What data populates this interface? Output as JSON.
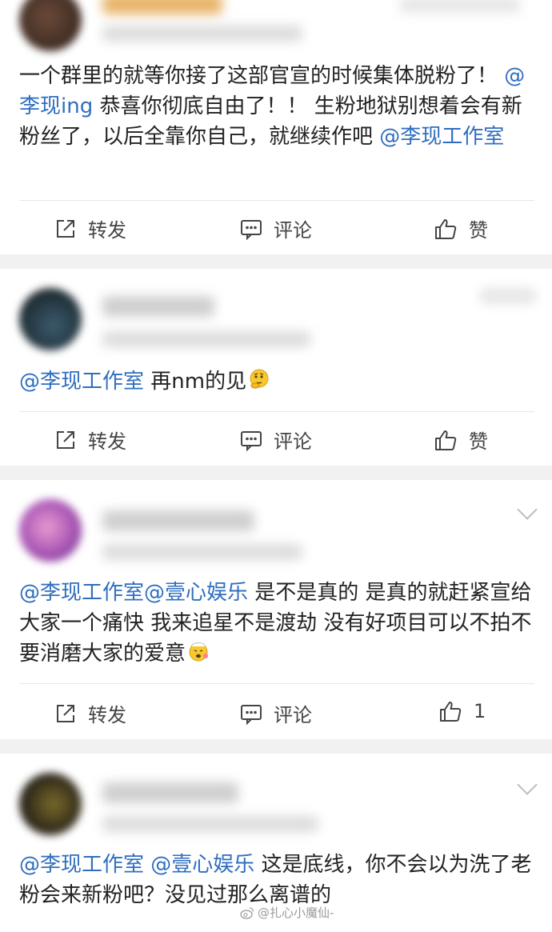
{
  "actions": {
    "repost_label": "转发",
    "comment_label": "评论",
    "like_label": "赞"
  },
  "posts": [
    {
      "body": [
        {
          "text": "一个群里的就等你接了这部官宣的时候集体脱粉了！ "
        },
        {
          "text": "@李现ing",
          "mention": true
        },
        {
          "text": " 恭喜你彻底自由了！！ 生粉地狱别想着会有新粉丝了，以后全靠你自己，就继续作吧 "
        },
        {
          "text": "@李现工作室",
          "mention": true
        }
      ],
      "like_count": ""
    },
    {
      "body": [
        {
          "text": "@李现工作室",
          "mention": true
        },
        {
          "text": " 再nm的见"
        }
      ],
      "emoji": "thinking-face-emoji",
      "like_count": ""
    },
    {
      "body": [
        {
          "text": "@李现工作室@壹心娱乐",
          "mention": true
        },
        {
          "text": "  是不是真的 是真的就赶紧宣给大家一个痛快 我来追星不是渡劫 没有好项目可以不拍不要消磨大家的爱意"
        }
      ],
      "emoji": "exploding-head-emoji",
      "like_count": "1"
    },
    {
      "body": [
        {
          "text": "@李现工作室 @壹心娱乐",
          "mention": true
        },
        {
          "text": " 这是底线，你不会以为洗了老粉会来新粉吧？没见过那么离谱的"
        }
      ]
    }
  ],
  "watermark": "@扎心小魔仙-",
  "colors": {
    "mention": "#2f6ebf",
    "background": "#f1f1f1",
    "card": "#ffffff"
  }
}
